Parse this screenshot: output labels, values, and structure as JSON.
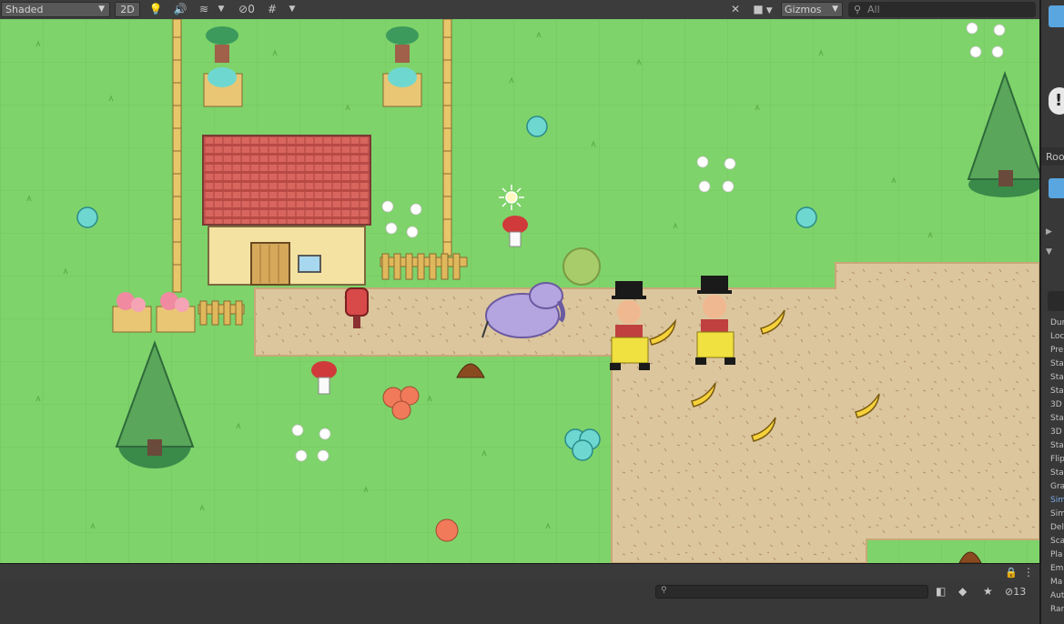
{
  "toolbar": {
    "shading_mode": "Shaded",
    "mode_2d_label": "2D",
    "hidden_count": "0",
    "gizmos_label": "Gizmos",
    "search_placeholder": "All"
  },
  "inspector": {
    "object_name": "Roo",
    "rows": [
      "Dur",
      "Loc",
      "Pre",
      "Sta",
      "Sta",
      "Sta",
      "3D",
      "Sta",
      "3D",
      "Sta",
      "Flip",
      "Sta",
      "Gra",
      "Sim",
      "Sim",
      "Del",
      "Sca",
      "Pla",
      "Em",
      "Ma",
      "Aut",
      "Rar"
    ],
    "highlighted_row_index": 13
  },
  "project": {
    "search_placeholder": "",
    "hidden_count": "13"
  },
  "colors": {
    "grass": "#7ed36a",
    "path": "#dcc69e",
    "roof": "#d0605a",
    "accent_link": "#7aa7e6"
  }
}
